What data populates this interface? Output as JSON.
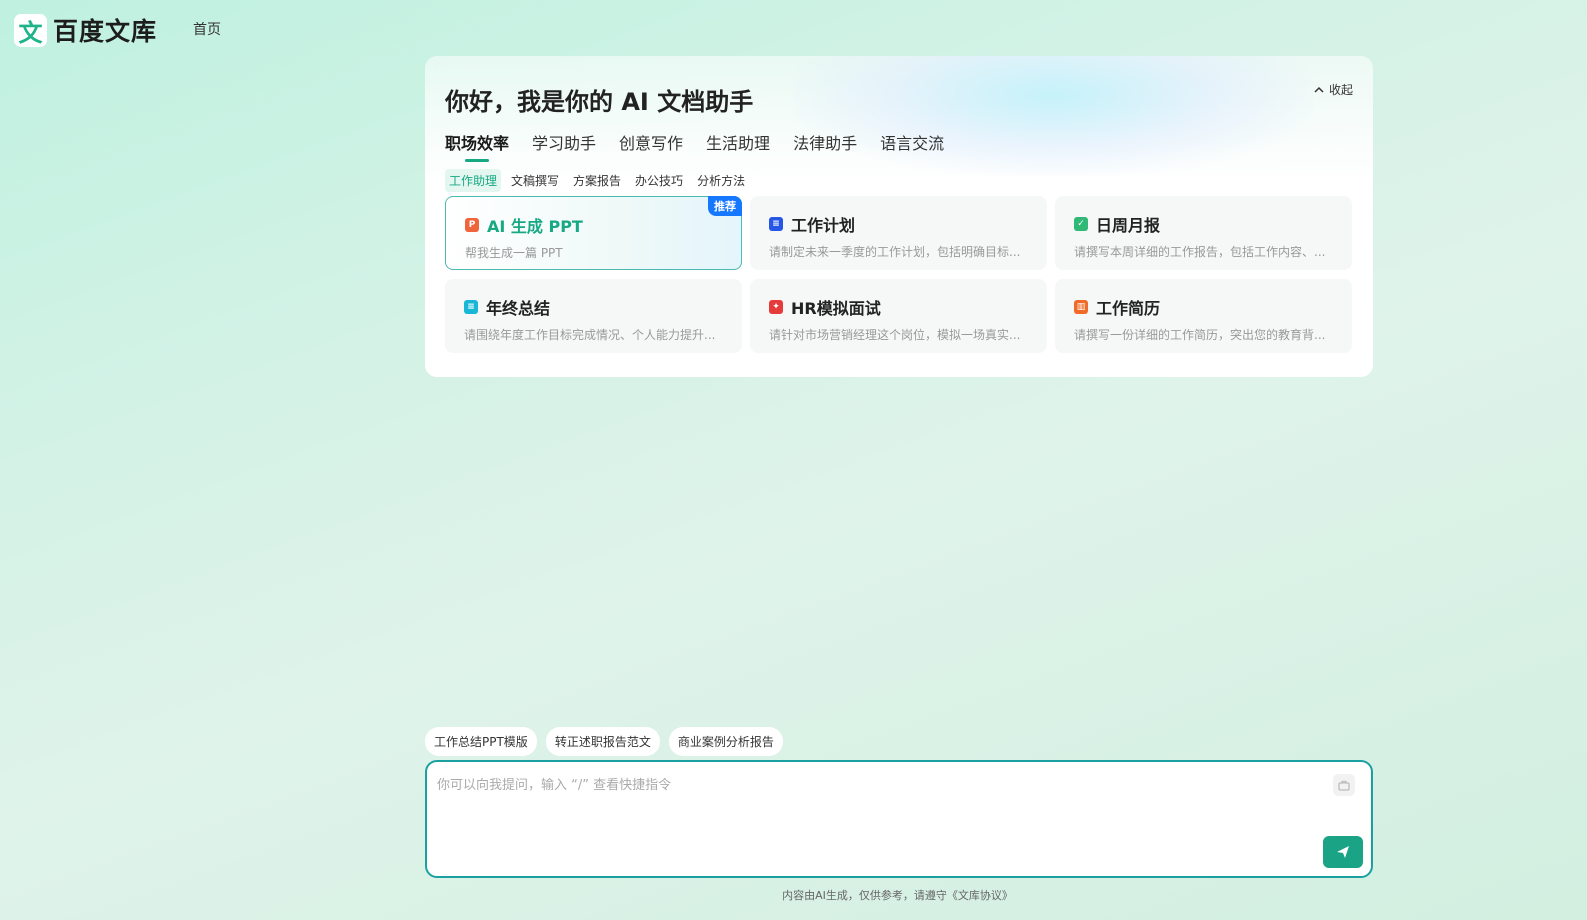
{
  "brand": {
    "logo_char": "文",
    "name": "百度文库"
  },
  "nav": {
    "home": "首页"
  },
  "panel": {
    "title": "你好，我是你的 AI 文档助手",
    "collapse_label": "收起",
    "categories": [
      "职场效率",
      "学习助手",
      "创意写作",
      "生活助理",
      "法律助手",
      "语言交流"
    ],
    "subcategories": [
      "工作助理",
      "文稿撰写",
      "方案报告",
      "办公技巧",
      "分析方法"
    ],
    "cards": [
      {
        "title": "AI 生成 PPT",
        "desc": "帮我生成一篇 PPT",
        "badge": "推荐",
        "icon": "ppt-icon",
        "color": "#f0643c"
      },
      {
        "title": "工作计划",
        "desc": "请制定未来一季度的工作计划，包括明确目标...",
        "icon": "doc-icon",
        "color": "#2556e6"
      },
      {
        "title": "日周月报",
        "desc": "请撰写本周详细的工作报告，包括工作内容、...",
        "icon": "check-icon",
        "color": "#2fb876"
      },
      {
        "title": "年终总结",
        "desc": "请围绕年度工作目标完成情况、个人能力提升...",
        "icon": "summary-icon",
        "color": "#19b7d6"
      },
      {
        "title": "HR模拟面试",
        "desc": "请针对市场营销经理这个岗位，模拟一场真实...",
        "icon": "pdf-icon",
        "color": "#e63b3b"
      },
      {
        "title": "工作简历",
        "desc": "请撰写一份详细的工作简历，突出您的教育背...",
        "icon": "resume-icon",
        "color": "#f06a2a"
      }
    ]
  },
  "quick_prompts": [
    "工作总结PPT模版",
    "转正述职报告范文",
    "商业案例分析报告"
  ],
  "input": {
    "placeholder": "你可以向我提问，输入 “/” 查看快捷指令"
  },
  "footer": {
    "note": "内容由AI生成，仅供参考，请遵守《文库协议》"
  }
}
